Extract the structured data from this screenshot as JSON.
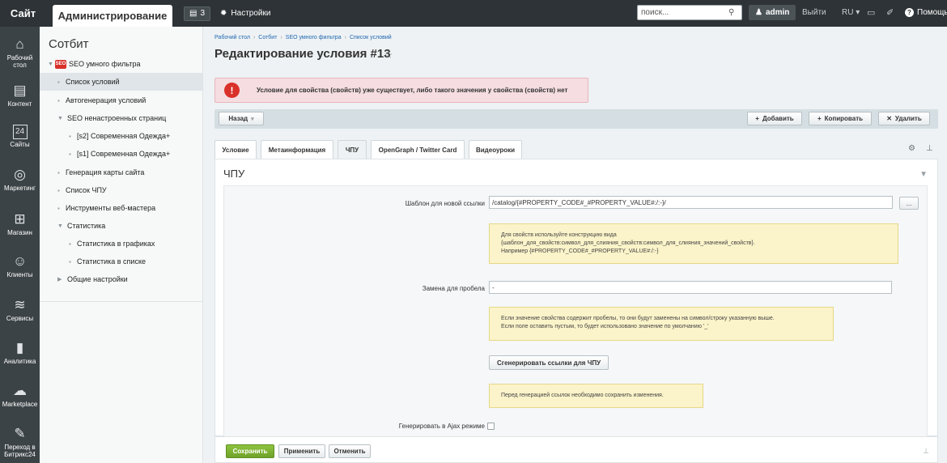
{
  "topbar": {
    "site_tab": "Сайт",
    "admin_tab": "Администрирование",
    "notifications_count": "3",
    "settings": "Настройки",
    "search_placeholder": "поиск...",
    "user": "admin",
    "logout": "Выйти",
    "lang": "RU",
    "help": "Помощь"
  },
  "rail": [
    {
      "icon": "home-icon",
      "glyph": "⌂",
      "label": "Рабочий стол"
    },
    {
      "icon": "content-icon",
      "glyph": "▤",
      "label": "Контент"
    },
    {
      "icon": "sites-icon",
      "glyph": "24",
      "label": "Сайты"
    },
    {
      "icon": "marketing-icon",
      "glyph": "◎",
      "label": "Маркетинг"
    },
    {
      "icon": "shop-icon",
      "glyph": "⊞",
      "label": "Магазин"
    },
    {
      "icon": "clients-icon",
      "glyph": "☺",
      "label": "Клиенты"
    },
    {
      "icon": "services-icon",
      "glyph": "≋",
      "label": "Сервисы"
    },
    {
      "icon": "analytics-icon",
      "glyph": "▮",
      "label": "Аналитика"
    },
    {
      "icon": "marketplace-icon",
      "glyph": "☁",
      "label": "Marketplace"
    },
    {
      "icon": "bitrix24-icon",
      "glyph": "✎",
      "label": "Переход в Битрикс24"
    }
  ],
  "menu": {
    "title": "Сотбит",
    "items": [
      {
        "label": "SEO умного фильтра",
        "type": "root"
      },
      {
        "label": "Список условий",
        "type": "item",
        "active": true
      },
      {
        "label": "Автогенерация условий",
        "type": "item"
      },
      {
        "label": "SEO ненастроенных страниц",
        "type": "group"
      },
      {
        "label": "[s2] Современная Одежда+",
        "type": "sub"
      },
      {
        "label": "[s1] Современная Одежда+",
        "type": "sub"
      },
      {
        "label": "Генерация карты сайта",
        "type": "item"
      },
      {
        "label": "Список ЧПУ",
        "type": "item"
      },
      {
        "label": "Инструменты веб-мастера",
        "type": "item"
      },
      {
        "label": "Статистика",
        "type": "group"
      },
      {
        "label": "Статистика в графиках",
        "type": "sub"
      },
      {
        "label": "Статистика в списке",
        "type": "sub"
      },
      {
        "label": "Общие настройки",
        "type": "collapsed"
      }
    ],
    "seo_badge": "SEO"
  },
  "breadcrumb": [
    "Рабочий стол",
    "Сотбит",
    "SEO умного фильтра",
    "Список условий"
  ],
  "page_title": "Редактирование условия #13",
  "alert": "Условие для свойства (свойств) уже существует, либо такого значения у свойства (свойств) нет",
  "toolbar": {
    "back": "Назад",
    "add": "Добавить",
    "copy": "Копировать",
    "delete": "Удалить"
  },
  "tabs": [
    "Условие",
    "Метаинформация",
    "ЧПУ",
    "OpenGraph / Twitter Card",
    "Видеоуроки"
  ],
  "section_title": "ЧПУ",
  "form": {
    "template_label": "Шаблон для новой ссылки",
    "template_value": "/catalog/{#PROPERTY_CODE#_#PROPERTY_VALUE#:/:-}/",
    "dots": "...",
    "note1": [
      "Для свойств используйте конструкцию вида",
      "{шаблон_для_свойств:символ_для_слияния_свойств:символ_для_слияния_значений_свойств}.",
      "Например {#PROPERTY_CODE#_#PROPERTY_VALUE#:/:-}"
    ],
    "space_label": "Замена для пробела",
    "space_value": "-",
    "note2": [
      "Если значение свойства содержит пробелы, то они будут заменены на символ/строку указанную выше.",
      "Если поле оставить пустым, то будет использовано значение по умолчанию '_'"
    ],
    "generate_button": "Сгенерировать ссылки для ЧПУ",
    "note3": "Перед генерацией ссылок необходимо сохранить изменения.",
    "ajax_label": "Генерировать в Ajax режиме"
  },
  "footer": {
    "save": "Сохранить",
    "apply": "Применить",
    "cancel": "Отменить"
  }
}
